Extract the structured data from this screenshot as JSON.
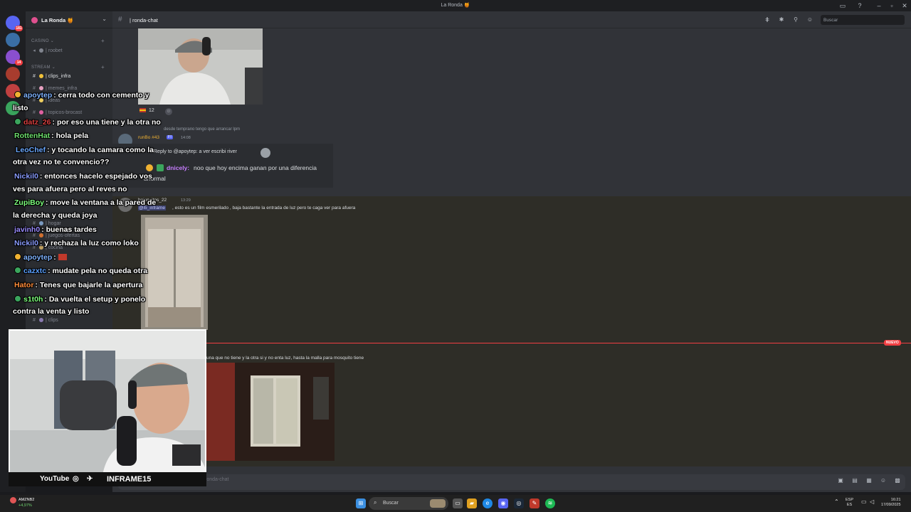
{
  "window": {
    "title": "La Ronda 🍯"
  },
  "rail": {
    "servers": [
      {
        "color": "#5865f2",
        "badge": "181"
      },
      {
        "color": "#3a6ea5",
        "badge": ""
      },
      {
        "color": "#8a4fcf",
        "badge": "14"
      },
      {
        "color": "#a83c2e",
        "badge": ""
      },
      {
        "color": "#c04040",
        "badge": ""
      },
      {
        "color": "#3aa55d",
        "badge": ""
      }
    ]
  },
  "sidebar": {
    "guild_name": "La Ronda 🍯",
    "categories": [
      {
        "label": "CASINO ⌄"
      },
      {
        "label": "STREAM ⌄"
      }
    ],
    "channels": [
      {
        "label": "| roobet",
        "bright": false
      },
      {
        "label": "| clips_infra",
        "bright": true
      },
      {
        "label": "| memes_infra",
        "bright": false
      },
      {
        "label": "| ideas",
        "bright": false
      },
      {
        "label": "| topicos-brocast",
        "bright": false
      },
      {
        "label": "| juegos-ofertas",
        "bright": false
      },
      {
        "label": "| hogar",
        "bright": false
      },
      {
        "label": "| cocina",
        "bright": false
      },
      {
        "label": "| clips",
        "bright": false
      }
    ]
  },
  "channel": {
    "name": "| ronda-chat",
    "search_placeholder": "Buscar"
  },
  "messages": {
    "reaction_count": "12",
    "reply_snippet": "desde temprano tengo que arrancar lpm",
    "msg_user": "runBo #43",
    "msg_tag": "FI",
    "msg_time": "14:08",
    "reply_to": "Reply to @apoytep: a ver escribi river",
    "dnicely_name": "dnicely:",
    "dnicely_text": "noo que hoy encima ganan por una diferencia",
    "dnicely_text2": "anormal",
    "poster_name": "baloncitos_22",
    "poster_time": "13:29",
    "mention": "@i5_inframe",
    "film_text": ", esto es un film esmerilado , baja bastante la entrada de luz pero te caga ver para afuera",
    "new_badge": "NUEVO",
    "last_text": "una que no tiene y la otra si y no enta luz, hasta la malla para mosquito tiene"
  },
  "composer": {
    "placeholder": "ronda-chat"
  },
  "stream_chat": [
    {
      "user": "apoytep",
      "color": "#7fb3ff",
      "text": ": cerra todo con cemento y",
      "cont": "listo"
    },
    {
      "user": "datz_26",
      "color": "#d94040",
      "text": ": por eso una tiene y la otra no",
      "cont": ""
    },
    {
      "user": "RottenHat",
      "color": "#6ee06e",
      "text": ": hola pela",
      "cont": ""
    },
    {
      "user": "LeoChef",
      "color": "#6aa8ff",
      "text": ": y tocando la camara como la",
      "cont": "otra vez no te convencio??"
    },
    {
      "user": "Nickil0",
      "color": "#8a9cff",
      "text": ": entonces hacelo espejado vos",
      "cont": "ves para afuera pero al reves no"
    },
    {
      "user": "ZupiBoy",
      "color": "#7dff7d",
      "text": ": move la ventana a la pared de",
      "cont": "la derecha y queda joya"
    },
    {
      "user": "javinh0",
      "color": "#9b8cff",
      "text": ": buenas tardes",
      "cont": ""
    },
    {
      "user": "Nickil0",
      "color": "#8a9cff",
      "text": ": y rechaza la luz como loko",
      "cont": ""
    },
    {
      "user": "apoytep",
      "color": "#7fb3ff",
      "text": ":",
      "cont": ""
    },
    {
      "user": "cazxtc",
      "color": "#5aa0ff",
      "text": ": mudate pela no queda otra",
      "cont": ""
    },
    {
      "user": "Hator",
      "color": "#ff8c3a",
      "text": ": Tenes que bajarle la apertura",
      "cont": ""
    },
    {
      "user": "s1t0h",
      "color": "#7dff7d",
      "text": ": Da vuelta el setup y ponelo",
      "cont": "contra la venta y listo"
    }
  ],
  "socials": {
    "youtube": "YouTube",
    "handle": "INFRAME15"
  },
  "taskbar": {
    "search": "Buscar",
    "stock_name": "AMZNB2",
    "stock_change": "+4,97%",
    "lang": "ESP",
    "lang2": "ES",
    "time": "16:21",
    "date": "17/09/2025"
  }
}
